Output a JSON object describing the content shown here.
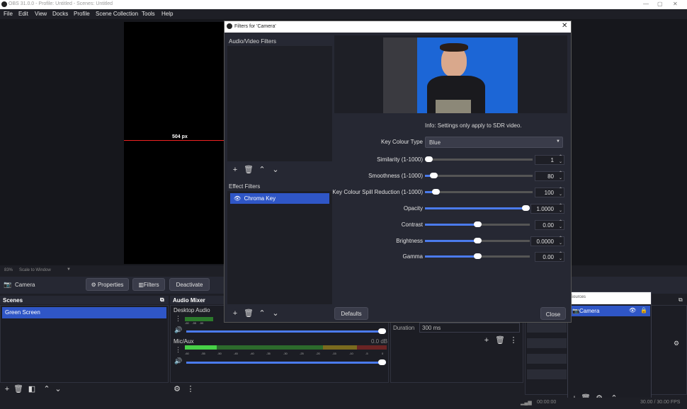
{
  "titlebar": {
    "title": "OBS 31.0.0 - Profile: Untitled - Scenes: Untitled"
  },
  "menu": [
    "File",
    "Edit",
    "View",
    "Docks",
    "Profile",
    "Scene Collection",
    "Tools",
    "Help"
  ],
  "preview": {
    "measure_label": "504 px"
  },
  "zoombar": {
    "zoom": "83%",
    "mode": "Scale to Window"
  },
  "source_bar": {
    "source": "Camera",
    "properties": "Properties",
    "filters": "Filters",
    "deactivate": "Deactivate"
  },
  "scenes": {
    "title": "Scenes",
    "items": [
      "Green Screen"
    ]
  },
  "audio_mixer": {
    "title": "Audio Mixer",
    "channels": [
      {
        "name": "Desktop Audio",
        "db": ""
      },
      {
        "name": "Mic/Aux",
        "db": "0.0 dB"
      }
    ],
    "ticks": [
      "-60",
      "-55",
      "-50",
      "-45",
      "-40",
      "-35",
      "-30",
      "-25",
      "-20",
      "-15",
      "-10",
      "-5",
      "0"
    ],
    "ticks_partial": [
      "-60",
      "-55",
      "-50"
    ]
  },
  "transitions": {
    "duration_label": "Duration",
    "duration_value": "300 ms"
  },
  "sources_panel": {
    "title": "Sources",
    "items": [
      {
        "name": "Camera"
      }
    ]
  },
  "statusbar": {
    "time": "00:00:00",
    "fps": "30.00 / 30.00 FPS"
  },
  "filters_window": {
    "title": "Filters for 'Camera'",
    "audio_video_label": "Audio/Video Filters",
    "effect_label": "Effect Filters",
    "effect_items": [
      "Chroma Key"
    ],
    "info": "Info: Settings only apply to SDR video.",
    "key_colour_type": {
      "label": "Key Colour Type",
      "value": "Blue"
    },
    "settings": [
      {
        "label": "Similarity (1-1000)",
        "value": "1",
        "level": 0.0
      },
      {
        "label": "Smoothness (1-1000)",
        "value": "80",
        "level": 0.08
      },
      {
        "label": "Key Colour Spill Reduction (1-1000)",
        "value": "100",
        "level": 0.1
      },
      {
        "label": "Opacity",
        "value": "1.0000",
        "level": 1.0
      },
      {
        "label": "Contrast",
        "value": "0.00",
        "level": 0.5
      },
      {
        "label": "Brightness",
        "value": "0.0000",
        "level": 0.5
      },
      {
        "label": "Gamma",
        "value": "0.00",
        "level": 0.5
      }
    ],
    "defaults": "Defaults",
    "close": "Close"
  },
  "colors": {
    "accent": "#4b7bec",
    "selection": "#2f56c6",
    "bg": "#1e1f26"
  }
}
